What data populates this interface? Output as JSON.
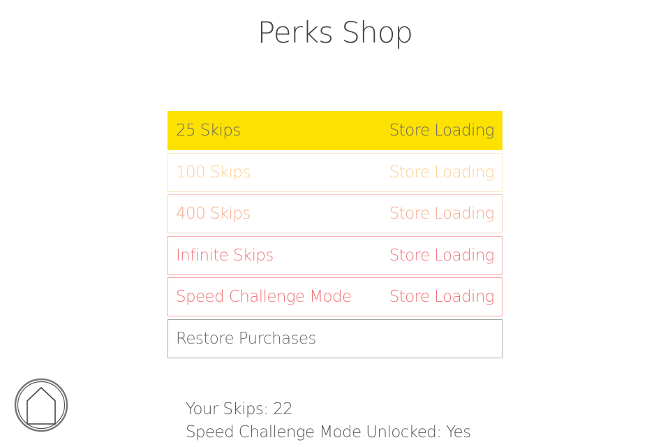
{
  "page": {
    "title": "Perks Shop"
  },
  "shop": {
    "items": [
      {
        "label": "25 Skips",
        "price": "Store Loading",
        "bg": "#FDE100",
        "border": "#FDE100",
        "color": "#666666"
      },
      {
        "label": "100 Skips",
        "price": "Store Loading",
        "bg": "#FFFFFF",
        "border": "#FDE7C4",
        "color": "#FCCD8F"
      },
      {
        "label": "400 Skips",
        "price": "Store Loading",
        "bg": "#FFFFFF",
        "border": "#FBCFC0",
        "color": "#F7A98A"
      },
      {
        "label": "Infinite Skips",
        "price": "Store Loading",
        "bg": "#FFFFFF",
        "border": "#F7A9A9",
        "color": "#F0757C"
      },
      {
        "label": "Speed Challenge Mode",
        "price": "Store Loading",
        "bg": "#FFFFFF",
        "border": "#F5A3A3",
        "color": "#F07275"
      },
      {
        "label": "Restore Purchases",
        "price": "",
        "bg": "#FFFFFF",
        "border": "#AAAAAA",
        "color": "#666666"
      }
    ]
  },
  "home_button": {
    "icon": "home-icon"
  },
  "stats": {
    "skips_label": "Your Skips:",
    "skips_value": "22",
    "speed_label": "Speed Challenge Mode Unlocked:",
    "speed_value": "Yes"
  }
}
